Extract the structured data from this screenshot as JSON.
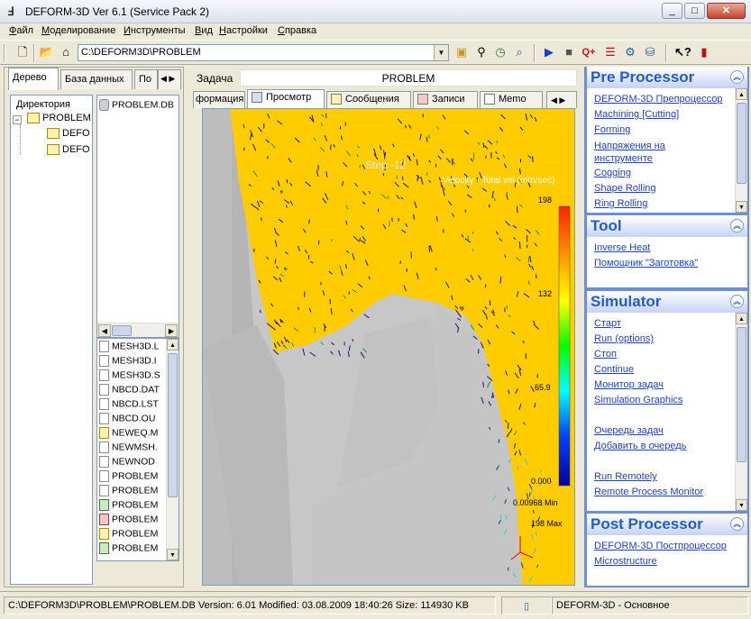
{
  "window": {
    "title": "DEFORM-3D  Ver 6.1 (Service Pack 2)",
    "controls": [
      "minimize",
      "maximize",
      "close"
    ]
  },
  "menu": [
    "Файл",
    "Моделирование",
    "Инструменты",
    "Вид",
    "Настройки",
    "Справка"
  ],
  "toolbar": {
    "path": "C:\\DEFORM3D\\PROBLEM",
    "icons": [
      "new-icon",
      "open-folder-icon",
      "home-icon",
      "folder-up-icon",
      "file-attach-icon",
      "clock-icon",
      "magnifier-icon",
      "run-icon",
      "stop-icon",
      "q-add-icon",
      "list-icon",
      "process-icon",
      "db-icon",
      "help-cursor-icon",
      "exit-door-icon"
    ]
  },
  "left": {
    "tabs": [
      "Дерево",
      "База данных",
      "По"
    ],
    "dir_header": "Директория",
    "tree": [
      {
        "label": "PROBLEM",
        "level": 0
      },
      {
        "label": "DEFO",
        "level": 1
      },
      {
        "label": "DEFO",
        "level": 1
      }
    ],
    "top_files": [
      "PROBLEM.DB"
    ],
    "bottom_files": [
      {
        "name": "MESH3D.L",
        "icon": "doc"
      },
      {
        "name": "MESH3D.I",
        "icon": "doc"
      },
      {
        "name": "MESH3D.S",
        "icon": "doc"
      },
      {
        "name": "NBCD.DAT",
        "icon": "doc"
      },
      {
        "name": "NBCD.LST",
        "icon": "doc"
      },
      {
        "name": "NBCD.OU",
        "icon": "doc"
      },
      {
        "name": "NEWEQ.M",
        "icon": "ylw"
      },
      {
        "name": "NEWMSH.",
        "icon": "doc"
      },
      {
        "name": "NEWNOD",
        "icon": "doc"
      },
      {
        "name": "PROBLEM",
        "icon": "doc"
      },
      {
        "name": "PROBLEM",
        "icon": "doc"
      },
      {
        "name": "PROBLEM",
        "icon": "grn"
      },
      {
        "name": "PROBLEM",
        "icon": "red"
      },
      {
        "name": "PROBLEM",
        "icon": "ylw"
      },
      {
        "name": "PROBLEM",
        "icon": "grn"
      }
    ]
  },
  "center": {
    "task_label": "Задача",
    "task_value": "PROBLEM",
    "tabs": [
      "формация",
      "Просмотр",
      "Сообщения",
      "Записи",
      "Memo"
    ],
    "active_tab": "Просмотр",
    "viewport": {
      "step_text": "Step -12",
      "legend_title": "Velocity - Total vel (mm/sec)",
      "legend_values": [
        "198",
        "132",
        "65.9",
        "0.000"
      ],
      "min_label": "0.00968 Min",
      "max_label": "198 Max"
    }
  },
  "right": {
    "sections": [
      {
        "title": "Pre Processor",
        "links": [
          "DEFORM-3D Препроцессор",
          "Machining [Cutting]",
          "Forming",
          "Напряжения на инструменте",
          "Cogging",
          "Shape Rolling",
          "Ring Rolling"
        ]
      },
      {
        "title": "Tool",
        "links": [
          "Inverse Heat",
          "Помощник \"Заготовка\""
        ]
      },
      {
        "title": "Simulator",
        "links": [
          "Старт",
          "Run (options)",
          "Стоп",
          "Continue",
          "Монитор задач",
          "Simulation Graphics",
          "Очередь задач",
          "Добавить в очередь",
          "Run Remotely",
          "Remote Process Monitor"
        ]
      },
      {
        "title": "Post Processor",
        "links": [
          "DEFORM-3D Постпроцессор",
          "Microstructure"
        ]
      }
    ]
  },
  "status": {
    "file_info": "C:\\DEFORM3D\\PROBLEM\\PROBLEM.DB  Version: 6.01  Modified: 03.08.2009  18:40:26  Size: 114930 KB",
    "mode": "DEFORM-3D  -  Основное"
  },
  "colors": {
    "workpiece": "#ffcc00",
    "die": "#c7c7c7",
    "link": "#2040c8",
    "section_title": "#215dc6",
    "panel_bg": "#6b8ed6"
  }
}
